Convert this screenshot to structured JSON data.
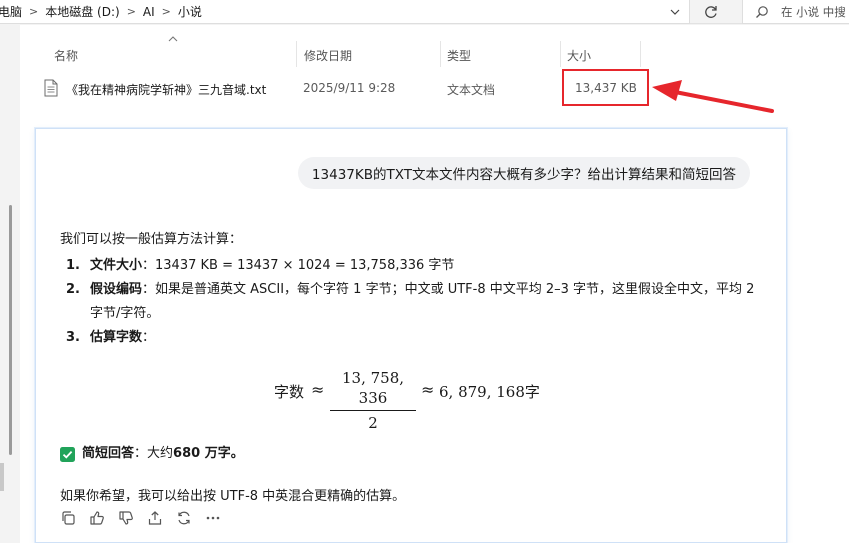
{
  "address_bar": {
    "crumbs": [
      "电脑",
      "本地磁盘 (D:)",
      "AI",
      "小说"
    ]
  },
  "search": {
    "placeholder": "在 小说 中搜"
  },
  "columns": {
    "name": "名称",
    "modified": "修改日期",
    "type": "类型",
    "size": "大小"
  },
  "file": {
    "name": "《我在精神病院学斩神》三九音域.txt",
    "modified": "2025/9/11 9:28",
    "type": "文本文档",
    "size": "13,437 KB"
  },
  "chat": {
    "question": "13437KB的TXT文本文件内容大概有多少字？给出计算结果和简短回答",
    "intro": "我们可以按一般估算方法计算：",
    "steps": [
      {
        "num": "1.",
        "key": "文件大小",
        "text": "：13437 KB = 13437 × 1024 = 13,758,336 字节"
      },
      {
        "num": "2.",
        "key": "假设编码",
        "text": "：如果是普通英文 ASCII，每个字符 1 字节；中文或 UTF-8 中文平均 2–3 字节，这里假设全中文，平均 2 字节/字符。"
      },
      {
        "num": "3.",
        "key": "估算字数",
        "text": "："
      }
    ],
    "formula": {
      "lhs": "字数",
      "approx": "≈",
      "numerator": "13, 758, 336",
      "denominator": "2",
      "result": "6, 879, 168",
      "unit": "字"
    },
    "summary": {
      "key": "简短回答",
      "text": "：大约 ",
      "value": "680 万字。"
    },
    "closing": "如果你希望，我可以给出按 UTF-8 中英混合更精确的估算。"
  },
  "colors": {
    "highlight": "#e6262c",
    "check_green": "#21a35a"
  }
}
